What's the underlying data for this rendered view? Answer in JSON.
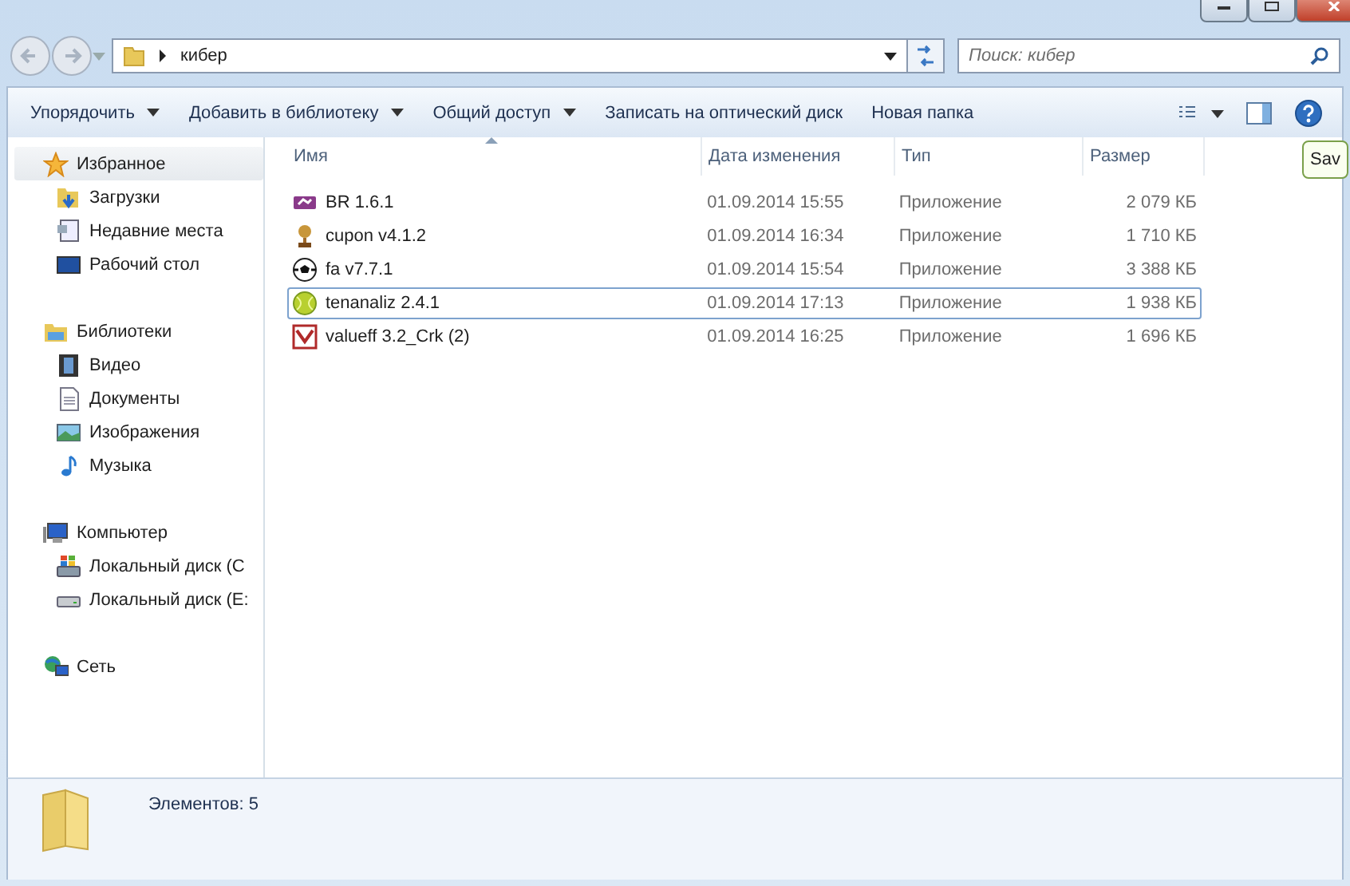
{
  "address_bar": {
    "path": "кибер",
    "search": {
      "placeholder": "Поиск: кибер"
    }
  },
  "toolbar": [
    {
      "label": "Упорядочить",
      "dropdown": true
    },
    {
      "label": "Добавить в библиотеку",
      "dropdown": true
    },
    {
      "label": "Общий доступ",
      "dropdown": true
    },
    {
      "label": "Записать на оптический диск",
      "dropdown": false
    },
    {
      "label": "Новая папка",
      "dropdown": false
    }
  ],
  "sidebar": [
    {
      "label": "Избранное",
      "selected": true,
      "children": [
        {
          "label": "Загрузки",
          "selected": false
        },
        {
          "label": "Недавние места",
          "selected": false
        },
        {
          "label": "Рабочий стол",
          "selected": false
        }
      ]
    },
    {
      "label": "Библиотеки",
      "selected": false,
      "children": [
        {
          "label": "Видео",
          "selected": false
        },
        {
          "label": "Документы",
          "selected": false
        },
        {
          "label": "Изображения",
          "selected": false
        },
        {
          "label": "Музыка",
          "selected": false
        }
      ]
    },
    {
      "label": "Компьютер",
      "selected": false,
      "children": [
        {
          "label": "Локальный диск (С",
          "selected": false
        },
        {
          "label": "Локальный диск (E:",
          "selected": false
        }
      ]
    },
    {
      "label": "Сеть",
      "selected": false
    }
  ],
  "table": {
    "columns": [
      "Имя",
      "Дата изменения",
      "Тип",
      "Размер"
    ],
    "rows": [
      {
        "name": "BR 1.6.1",
        "date": "01.09.2014 15:55",
        "type": "Приложение",
        "size": "2 079 КБ",
        "selected": false
      },
      {
        "name": "cupon v4.1.2",
        "date": "01.09.2014 16:34",
        "type": "Приложение",
        "size": "1 710 КБ",
        "selected": false
      },
      {
        "name": "fa v7.7.1",
        "date": "01.09.2014 15:54",
        "type": "Приложение",
        "size": "3 388 КБ",
        "selected": false
      },
      {
        "name": "tenanaliz 2.4.1",
        "date": "01.09.2014 17:13",
        "type": "Приложение",
        "size": "1 938 КБ",
        "selected": true
      },
      {
        "name": "valueff 3.2_Crk (2)",
        "date": "01.09.2014 16:25",
        "type": "Приложение",
        "size": "1 696 КБ",
        "selected": false
      }
    ]
  },
  "tooltip": "Sav",
  "status_bar": {
    "count": "Элементов: 5"
  }
}
